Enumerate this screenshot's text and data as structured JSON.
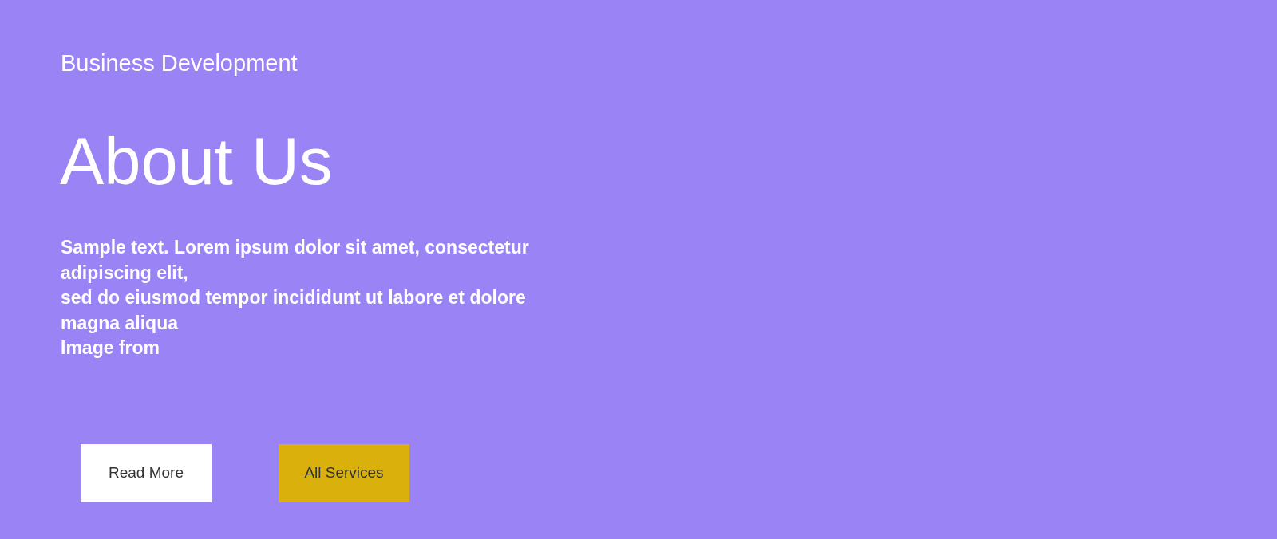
{
  "hero": {
    "eyebrow": "Business Development",
    "title": "About Us",
    "body_lines": [
      "Sample text. Lorem ipsum dolor sit amet, consectetur adipiscing elit,",
      "sed do eiusmod tempor incididunt ut labore et dolore magna aliqua",
      "Image from"
    ]
  },
  "buttons": [
    {
      "label": "Read More",
      "kind": "light"
    },
    {
      "label": "All Services",
      "kind": "accent"
    }
  ]
}
